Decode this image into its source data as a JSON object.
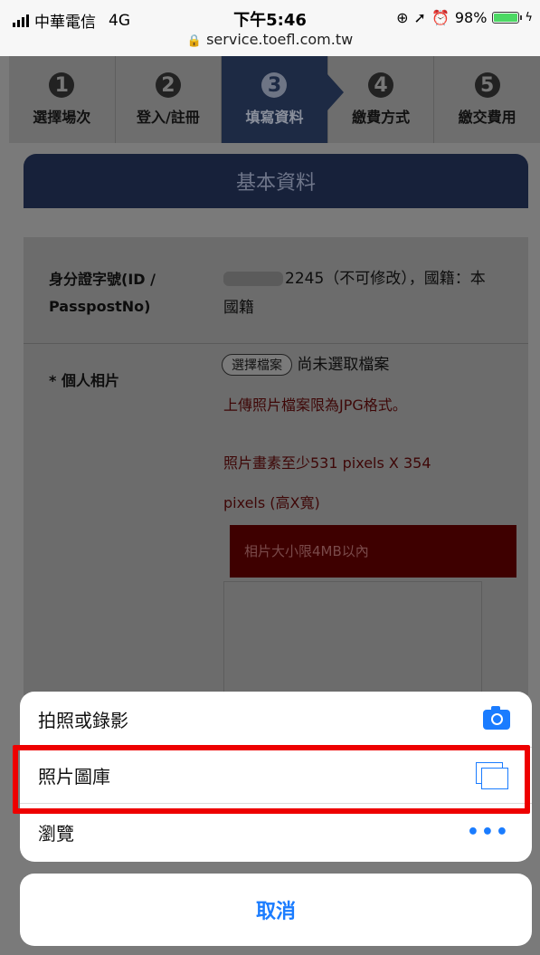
{
  "status_bar": {
    "carrier": "中華電信",
    "network": "4G",
    "time": "下午5:46",
    "url": "service.toefl.com.tw",
    "battery": "98%",
    "battery_level": 0.98
  },
  "steps": [
    {
      "number": "1",
      "label": "選擇場次",
      "active": false
    },
    {
      "number": "2",
      "label": "登入/註冊",
      "active": false
    },
    {
      "number": "3",
      "label": "填寫資料",
      "active": true
    },
    {
      "number": "4",
      "label": "繳費方式",
      "active": false
    },
    {
      "number": "5",
      "label": "繳交費用",
      "active": false
    }
  ],
  "section": {
    "title": "基本資料"
  },
  "form": {
    "id_label_line1": "身分證字號(ID /",
    "id_label_line2": "PasspostNo)",
    "id_value_suffix": "2245（不可修改）",
    "nationality_line1": "，國籍：本",
    "nationality_line2": "國籍",
    "photo_label": "* 個人相片",
    "choose_file_button": "選擇檔案",
    "no_file_text": "尚未選取檔案",
    "note_jpg": "上傳照片檔案限為JPG格式。",
    "note_pixels_line1": "照片畫素至少531 pixels X 354",
    "note_pixels_line2": "pixels (高X寬)",
    "note_size": "相片大小限4MB以內"
  },
  "action_sheet": {
    "items": [
      {
        "label": "拍照或錄影",
        "icon": "camera-icon"
      },
      {
        "label": "照片圖庫",
        "icon": "photo-library-icon"
      },
      {
        "label": "瀏覽",
        "icon": "more-icon"
      }
    ],
    "cancel_label": "取消",
    "accent_color": "#1a7cff",
    "highlight_color": "#ee0000"
  }
}
